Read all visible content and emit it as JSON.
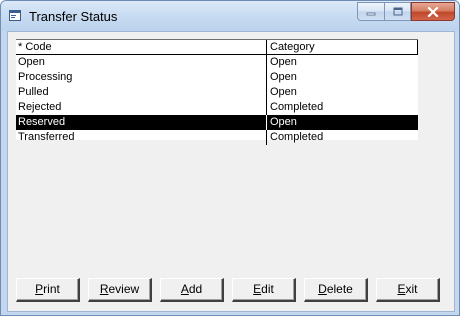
{
  "window": {
    "title": "Transfer Status",
    "icon": "app-window-icon",
    "caption_buttons": [
      "minimize-icon",
      "maximize-icon",
      "close-icon"
    ]
  },
  "grid": {
    "columns": [
      "* Code",
      "Category"
    ],
    "rows": [
      {
        "code": "Open",
        "category": "Open"
      },
      {
        "code": "Processing",
        "category": "Open"
      },
      {
        "code": "Pulled",
        "category": "Open"
      },
      {
        "code": "Rejected",
        "category": "Completed"
      },
      {
        "code": "Reserved",
        "category": "Open",
        "selected": true
      },
      {
        "code": "Transferred",
        "category": "Completed"
      }
    ]
  },
  "buttons": [
    {
      "first": "P",
      "rest": "rint"
    },
    {
      "first": "R",
      "rest": "eview"
    },
    {
      "first": "A",
      "rest": "dd"
    },
    {
      "first": "E",
      "rest": "dit"
    },
    {
      "first": "D",
      "rest": "elete"
    },
    {
      "first": "E",
      "rest": "xit"
    }
  ],
  "colors": {
    "selection_background": "#000000",
    "selection_text": "#ffffff",
    "dialog_background": "#f0f0f0",
    "close_button": "#c0482a"
  }
}
